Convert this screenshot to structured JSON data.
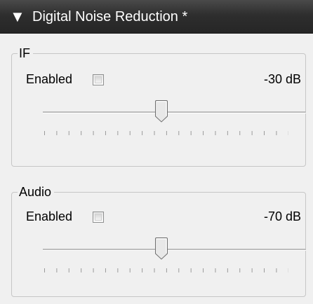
{
  "panel": {
    "title": "Digital Noise Reduction *",
    "expand_icon": "triangle-down-icon"
  },
  "groups": [
    {
      "legend": "IF",
      "enabled_label": "Enabled",
      "enabled_checked": false,
      "value_text": "-30 dB",
      "slider_level": 0.5
    },
    {
      "legend": "Audio",
      "enabled_label": "Enabled",
      "enabled_checked": false,
      "value_text": "-70 dB",
      "slider_level": 0.5
    }
  ]
}
